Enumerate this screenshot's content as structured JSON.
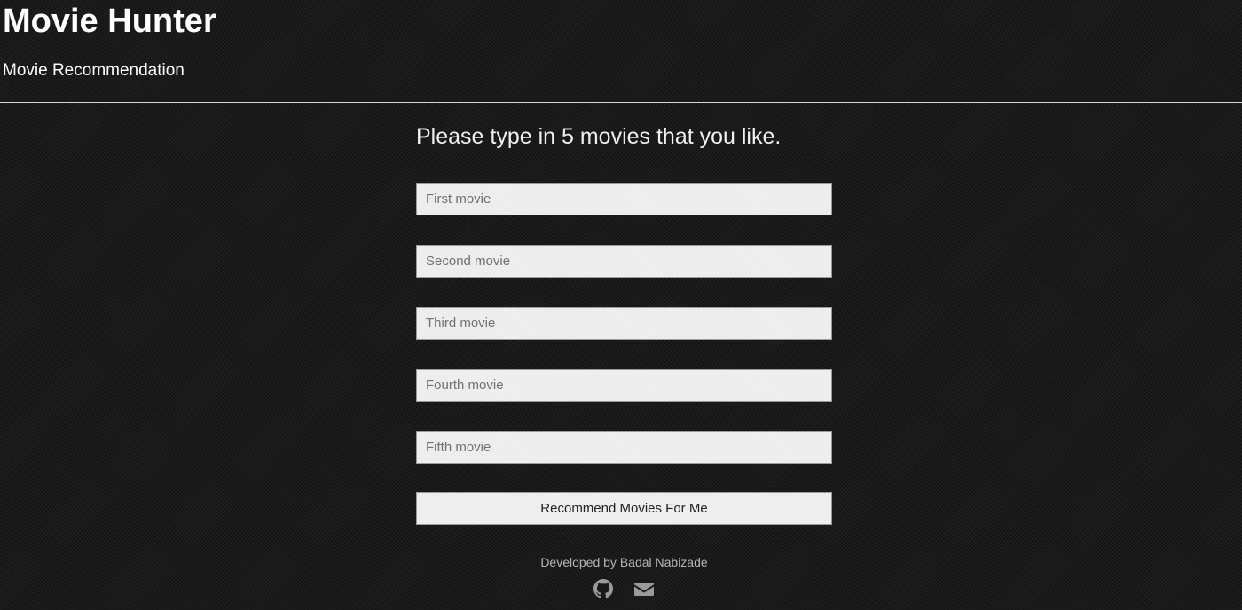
{
  "header": {
    "title": "Movie Hunter",
    "subtitle": "Movie Recommendation"
  },
  "form": {
    "prompt": "Please type in 5 movies that you like.",
    "inputs": [
      {
        "placeholder": "First movie",
        "value": ""
      },
      {
        "placeholder": "Second movie",
        "value": ""
      },
      {
        "placeholder": "Third movie",
        "value": ""
      },
      {
        "placeholder": "Fourth movie",
        "value": ""
      },
      {
        "placeholder": "Fifth movie",
        "value": ""
      }
    ],
    "submit_label": "Recommend Movies For Me"
  },
  "footer": {
    "credit": "Developed by Badal Nabizade",
    "icons": [
      "github-icon",
      "envelope-icon"
    ]
  },
  "colors": {
    "background": "#1a1a1a",
    "text": "#ffffff",
    "input_background": "#efefef",
    "footer_text": "#b5b5b5",
    "icon": "#9a9a9a"
  }
}
